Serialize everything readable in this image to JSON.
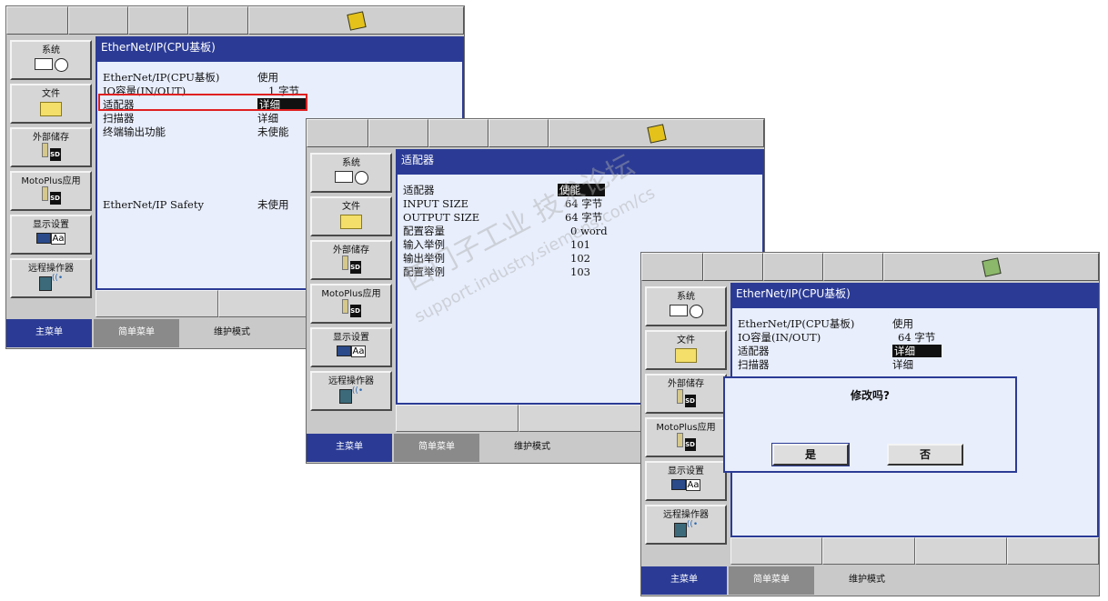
{
  "sidebar": {
    "items": [
      {
        "label": "系统",
        "icon": "system-clock-icon"
      },
      {
        "label": "文件",
        "icon": "folder-icon"
      },
      {
        "label": "外部储存",
        "icon": "sd-card-icon"
      },
      {
        "label": "MotoPlus应用",
        "icon": "sd-card-icon"
      },
      {
        "label": "显示设置",
        "icon": "display-icon"
      },
      {
        "label": "远程操作器",
        "icon": "pendant-icon"
      }
    ]
  },
  "bottom": {
    "main_menu": "主菜单",
    "simple_menu": "简单菜单",
    "maintenance": "维护模式"
  },
  "screen1": {
    "title": "EtherNet/IP(CPU基板)",
    "rows": [
      {
        "label": "EtherNet/IP(CPU基板)",
        "value": "使用"
      },
      {
        "label": "IO容量(IN/OUT)",
        "value": "1 字节"
      },
      {
        "label": "适配器",
        "value": "详细"
      },
      {
        "label": "扫描器",
        "value": "详细"
      },
      {
        "label": "终端输出功能",
        "value": "未使能"
      },
      {
        "label": "EtherNet/IP Safety",
        "value": "未使用"
      }
    ]
  },
  "screen2": {
    "title": "适配器",
    "rows": [
      {
        "label": "适配器",
        "value": "使能"
      },
      {
        "label": "INPUT SIZE",
        "value": "64 字节"
      },
      {
        "label": "OUTPUT SIZE",
        "value": "64 字节"
      },
      {
        "label": "配置容量",
        "value": "0 word"
      },
      {
        "label": "输入举例",
        "value": "101"
      },
      {
        "label": "输出举例",
        "value": "102"
      },
      {
        "label": "配置举例",
        "value": "103"
      }
    ]
  },
  "screen3": {
    "title": "EtherNet/IP(CPU基板)",
    "rows": [
      {
        "label": "EtherNet/IP(CPU基板)",
        "value": "使用"
      },
      {
        "label": "IO容量(IN/OUT)",
        "value": "64 字节"
      },
      {
        "label": "适配器",
        "value": "详细"
      },
      {
        "label": "扫描器",
        "value": "详细"
      }
    ],
    "dialog": {
      "question": "修改吗?",
      "yes": "是",
      "no": "否"
    }
  },
  "watermark": {
    "line1": "西门子工业 技术论坛",
    "line2": "support.industry.siemens.com/cs"
  }
}
